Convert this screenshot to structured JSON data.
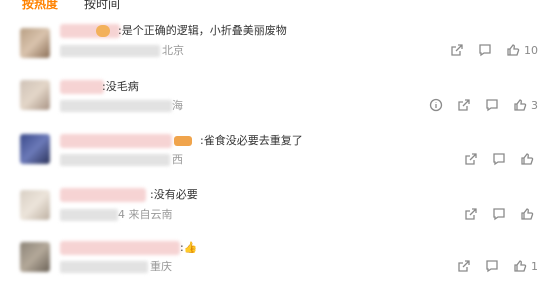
{
  "tabs": [
    {
      "label": "按热度",
      "active": true
    },
    {
      "label": "按时间",
      "active": false
    }
  ],
  "comments": [
    {
      "text": ":是个正确的逻辑，小折叠美丽废物",
      "location": "北京",
      "likes": "10"
    },
    {
      "text": ":没毛病",
      "location": "海",
      "likes": "3"
    },
    {
      "text": ":雀食没必要去重复了",
      "location": "西",
      "likes": ""
    },
    {
      "text": ":没有必要",
      "location": "4 来自云南",
      "likes": ""
    },
    {
      "text": ":",
      "emoji": "👍",
      "location": "重庆",
      "likes": "1"
    }
  ],
  "colors": {
    "accent": "#ff8200",
    "muted": "#999999"
  }
}
